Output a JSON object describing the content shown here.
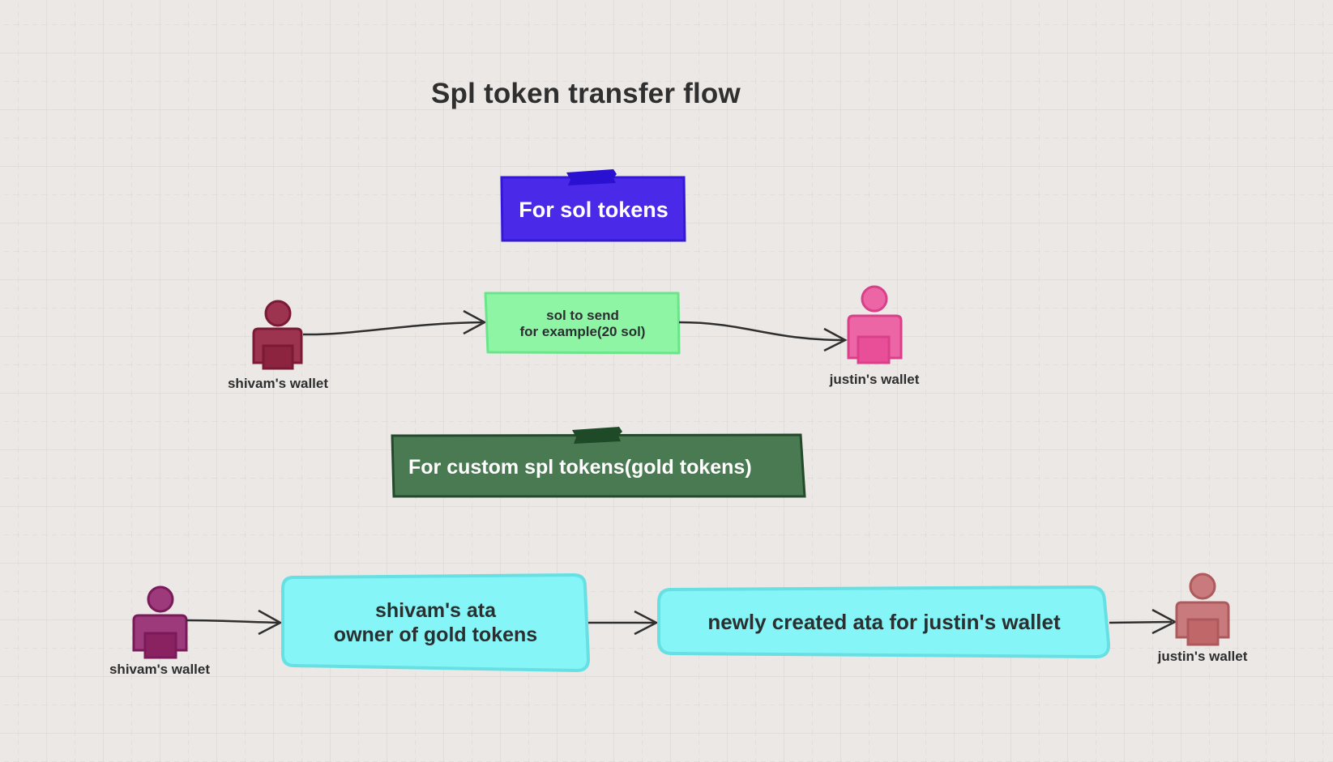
{
  "title": "Spl token transfer flow",
  "colors": {
    "background": "#ebe8e6",
    "grid_major": "#dcd9d7",
    "grid_minor": "#d8d5d3",
    "sol_note_fill": "#4a2ae8",
    "sol_note_border": "#3418d8",
    "spl_note_fill": "#4a7a52",
    "spl_note_border": "#244a2c",
    "green_box_fill": "#8ef5a5",
    "green_box_border": "#6ae58a",
    "cyan_box_fill": "#86f5f7",
    "cyan_box_border": "#66e0e3",
    "arrow": "#2f2f2f",
    "wallet_shivam_1": "#8c2440",
    "wallet_justin_1": "#e84f98",
    "wallet_shivam_2": "#8a2262",
    "wallet_justin_2": "#c0676a"
  },
  "sections": {
    "sol": {
      "heading": "For sol tokens",
      "sender_label": "shivam's wallet",
      "transfer_box": "sol to send\nfor example(20 sol)",
      "receiver_label": "justin's wallet"
    },
    "spl": {
      "heading": "For custom spl tokens(gold tokens)",
      "sender_label": "shivam's wallet",
      "sender_ata_box": "shivam's ata\nowner of gold tokens",
      "receiver_ata_box": "newly created ata for justin's wallet",
      "receiver_label": "justin's wallet"
    }
  },
  "icons": {
    "wallet": "person-icon",
    "note_tape": "tape-icon",
    "arrow": "arrow-right-icon"
  }
}
